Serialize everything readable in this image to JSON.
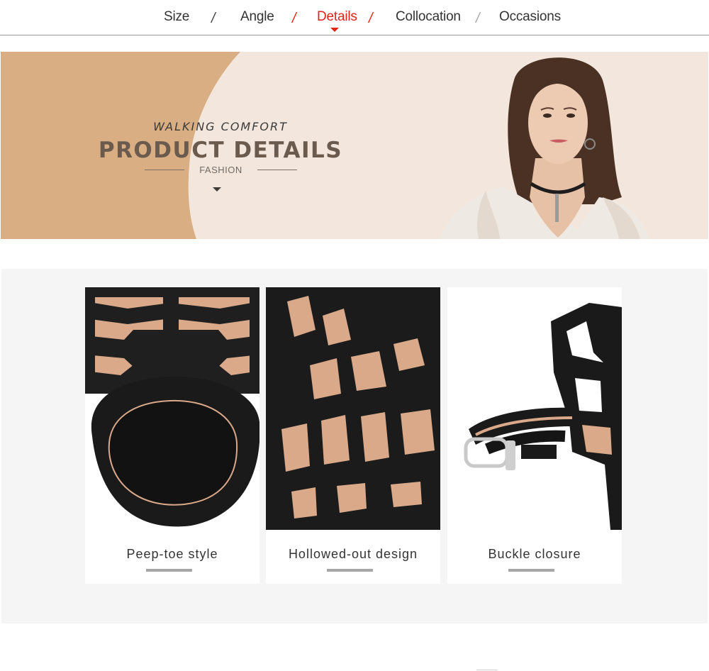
{
  "nav": {
    "items": [
      {
        "label": "Size",
        "active": false
      },
      {
        "label": "Angle",
        "active": false
      },
      {
        "label": "Details",
        "active": true
      },
      {
        "label": "Collocation",
        "active": false
      },
      {
        "label": "Occasions",
        "active": false
      }
    ],
    "separator": "/",
    "active_color": "#e0251b"
  },
  "banner": {
    "kicker": "WALKING COMFORT",
    "title": "PRODUCT DETAILS",
    "subtitle": "FASHION",
    "colors": {
      "tan": "#d9ae82",
      "cream": "#f3e7dd"
    }
  },
  "details": {
    "cards": [
      {
        "caption": "Peep-toe style",
        "icon": "peep-toe-photo"
      },
      {
        "caption": "Hollowed-out design",
        "icon": "hollowed-out-photo"
      },
      {
        "caption": "Buckle closure",
        "icon": "buckle-photo"
      }
    ],
    "background": "#f5f5f5"
  }
}
